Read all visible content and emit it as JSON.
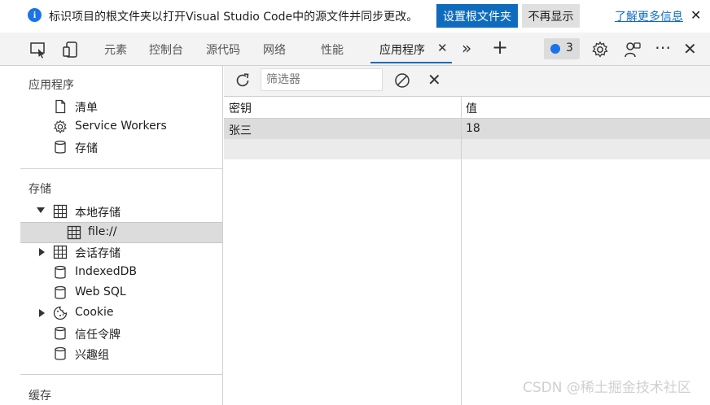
{
  "infobar": {
    "icon": "info-icon",
    "message": "标识项目的根文件夹以打开Visual Studio Code中的源文件并同步更改。",
    "primary_button": "设置根文件夹",
    "secondary_button": "不再显示",
    "link": "了解更多信息"
  },
  "toolbar": {
    "tabs": [
      "元素",
      "控制台",
      "源代码",
      "网络",
      "性能",
      "应用程序"
    ],
    "active_tab": "应用程序",
    "issues_count": "3"
  },
  "sidebar": {
    "app_section": "应用程序",
    "app_items": [
      "清单",
      "Service Workers",
      "存储"
    ],
    "storage_section": "存储",
    "local_storage": "本地存储",
    "local_storage_child": "file://",
    "session_storage": "会话存储",
    "indexeddb": "IndexedDB",
    "websql": "Web SQL",
    "cookie": "Cookie",
    "trust_tokens": "信任令牌",
    "interest_groups": "兴趣组",
    "cache_section": "缓存"
  },
  "main": {
    "filter_placeholder": "筛选器",
    "columns": {
      "key": "密钥",
      "value": "值"
    },
    "rows": [
      {
        "key": "张三",
        "value": "18"
      }
    ]
  },
  "watermark": "CSDN @稀土掘金技术社区"
}
